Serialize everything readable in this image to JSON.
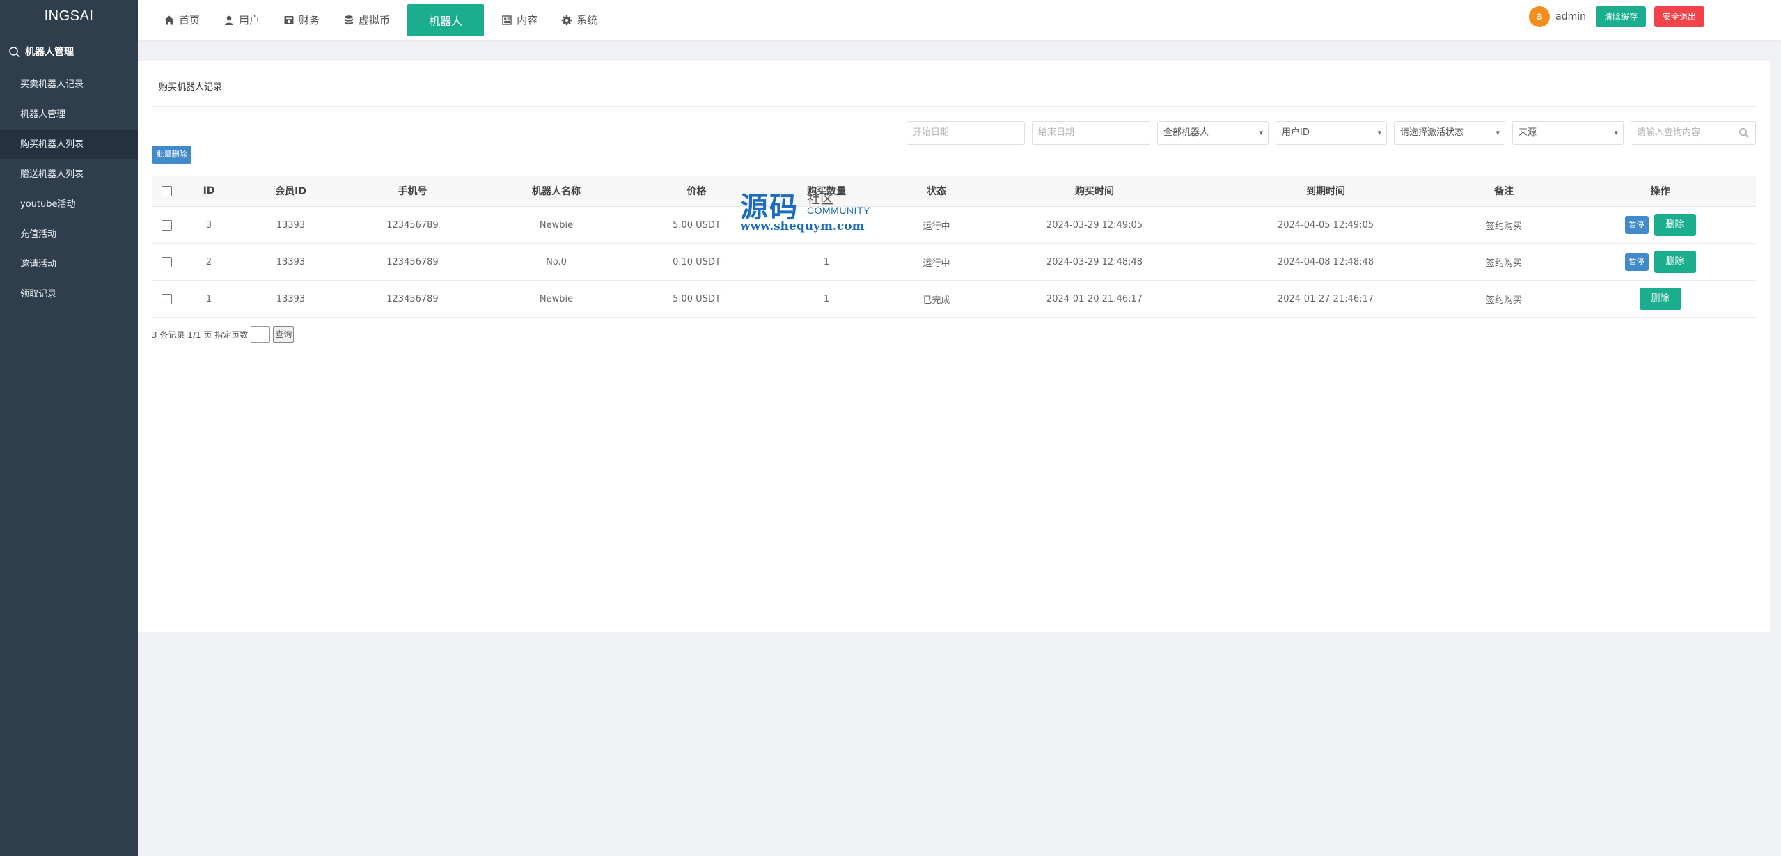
{
  "brand": "INGSAI",
  "sidebar": {
    "group_label": "机器人管理",
    "items": [
      {
        "label": "买卖机器人记录"
      },
      {
        "label": "机器人管理"
      },
      {
        "label": "购买机器人列表"
      },
      {
        "label": "赠送机器人列表"
      },
      {
        "label": "youtube活动"
      },
      {
        "label": "充值活动"
      },
      {
        "label": "邀请活动"
      },
      {
        "label": "领取记录"
      }
    ],
    "active_index": 2
  },
  "header": {
    "tabs": [
      {
        "label": "首页",
        "icon": "home-icon"
      },
      {
        "label": "用户",
        "icon": "user-icon"
      },
      {
        "label": "财务",
        "icon": "wallet-icon"
      },
      {
        "label": "虚拟币",
        "icon": "database-icon"
      },
      {
        "label": "机器人",
        "icon": ""
      },
      {
        "label": "内容",
        "icon": "document-icon"
      },
      {
        "label": "系统",
        "icon": "gear-icon"
      }
    ],
    "active_tab": "机器人",
    "avatar_letter": "a",
    "username": "admin",
    "clear_cache_label": "清除缓存",
    "logout_label": "安全退出"
  },
  "panel": {
    "title": "购买机器人记录",
    "filters": {
      "start_date_placeholder": "开始日期",
      "end_date_placeholder": "结束日期",
      "robot_select": "全部机器人",
      "user_id_select": "用户ID",
      "status_select": "请选择激活状态",
      "source_select": "来源",
      "search_placeholder": "请输入查询内容"
    },
    "batch_delete_label": "批量删除"
  },
  "table": {
    "columns": [
      "ID",
      "会员ID",
      "手机号",
      "机器人名称",
      "价格",
      "购买数量",
      "状态",
      "购买时间",
      "到期时间",
      "备注",
      "操作"
    ],
    "rows": [
      {
        "id": "3",
        "member_id": "13393",
        "phone": "123456789",
        "robot": "Newbie",
        "price": "5.00 USDT",
        "qty": "",
        "status": "运行中",
        "buy_time": "2024-03-29 12:49:05",
        "expire_time": "2024-04-05 12:49:05",
        "note": "签约购买",
        "pause": "暂停",
        "delete": "删除"
      },
      {
        "id": "2",
        "member_id": "13393",
        "phone": "123456789",
        "robot": "No.0",
        "price": "0.10 USDT",
        "qty": "1",
        "status": "运行中",
        "buy_time": "2024-03-29 12:48:48",
        "expire_time": "2024-04-08 12:48:48",
        "note": "签约购买",
        "pause": "暂停",
        "delete": "删除"
      },
      {
        "id": "1",
        "member_id": "13393",
        "phone": "123456789",
        "robot": "Newbie",
        "price": "5.00 USDT",
        "qty": "1",
        "status": "已完成",
        "buy_time": "2024-01-20 21:46:17",
        "expire_time": "2024-01-27 21:46:17",
        "note": "签约购买",
        "pause": "",
        "delete": "删除"
      }
    ]
  },
  "pagination": {
    "summary": "3 条记录 1/1 页 指定页数",
    "go_label": "查询"
  },
  "watermark": {
    "big": "源码",
    "small": "社区",
    "community": "COMMUNITY",
    "url": "www.shequym.com"
  }
}
